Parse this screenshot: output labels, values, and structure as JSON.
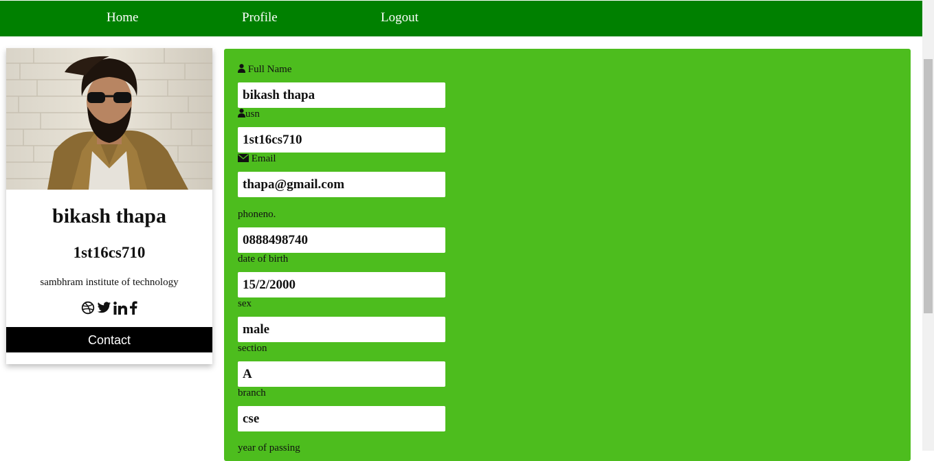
{
  "nav": {
    "home": "Home",
    "profile": "Profile",
    "logout": "Logout"
  },
  "profile_card": {
    "name": "bikash thapa",
    "usn": "1st16cs710",
    "college": "sambhram institute of technology",
    "contact_label": "Contact",
    "social_icons": [
      "dribbble-icon",
      "twitter-icon",
      "linkedin-icon",
      "facebook-icon"
    ]
  },
  "form": {
    "fields": [
      {
        "label": "Full Name",
        "icon": "user-icon",
        "value": "bikash thapa"
      },
      {
        "label": "usn",
        "icon": "user-icon",
        "value": "1st16cs710"
      },
      {
        "label": "Email",
        "icon": "envelope-icon",
        "value": "thapa@gmail.com"
      },
      {
        "label": "phoneno.",
        "value": "0888498740"
      },
      {
        "label": "date of birth",
        "value": "15/2/2000"
      },
      {
        "label": "sex",
        "value": "male"
      },
      {
        "label": "section",
        "value": "A"
      },
      {
        "label": "branch",
        "value": "cse"
      },
      {
        "label": "year of passing"
      }
    ]
  },
  "colors": {
    "navbar": "#008000",
    "form_panel": "#4dbd1e",
    "contact_button": "#000000"
  }
}
